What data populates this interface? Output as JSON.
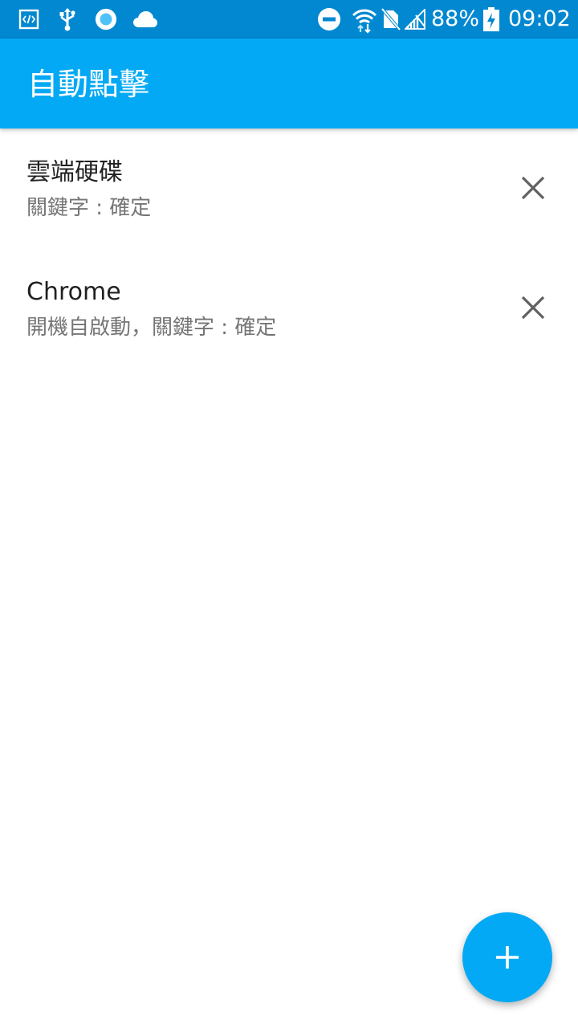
{
  "status_bar": {
    "battery_percent": "88%",
    "time": "09:02",
    "left_icons": [
      "developer-code-icon",
      "usb-icon",
      "record-dot-icon",
      "cloud-icon"
    ],
    "right_icons": [
      "do-not-disturb-icon",
      "wifi-icon",
      "no-sim-icon",
      "signal-icon",
      "battery-charging-icon"
    ]
  },
  "app_bar": {
    "title": "自動點擊"
  },
  "items": [
    {
      "title": "雲端硬碟",
      "subtitle": "關鍵字 : 確定"
    },
    {
      "title": "Chrome",
      "subtitle": "開機自啟動，關鍵字 : 確定"
    }
  ],
  "colors": {
    "status_bar": "#0288D1",
    "primary": "#03A9F4",
    "title_text": "#212121",
    "subtitle_text": "#757575",
    "icon_grey": "#616161"
  },
  "fab": {
    "icon": "plus-icon"
  }
}
